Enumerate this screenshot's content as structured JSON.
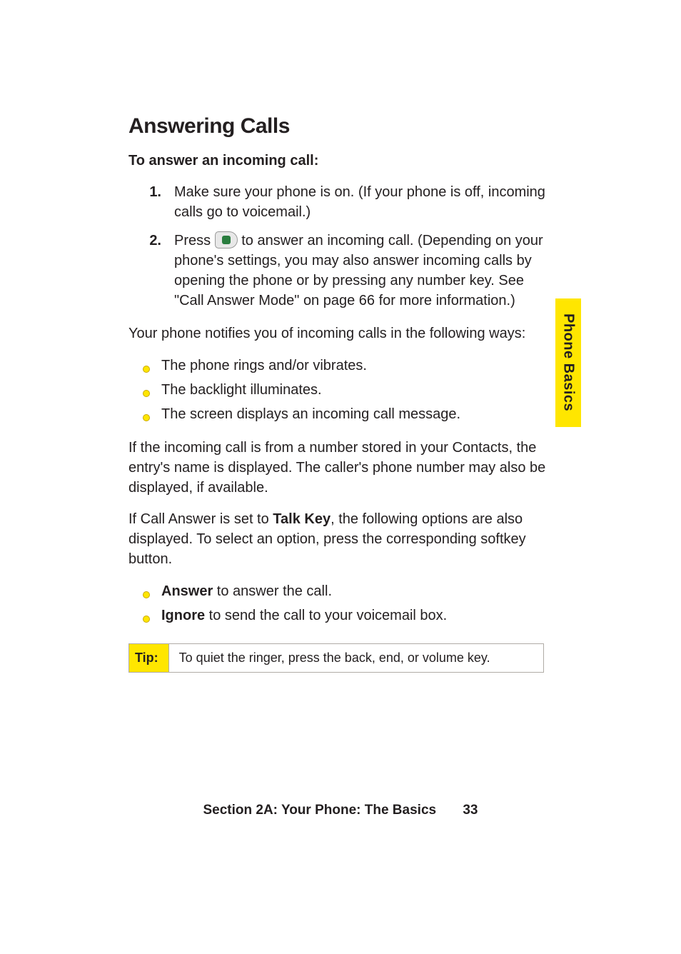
{
  "side_tab": {
    "label": "Phone Basics"
  },
  "heading": "Answering Calls",
  "subhead": "To answer an incoming call:",
  "steps": [
    {
      "marker": "1.",
      "text": "Make sure your phone is on. (If your phone is off, incoming calls go to voicemail.)"
    },
    {
      "marker": "2.",
      "prefix": "Press ",
      "suffix": " to answer an incoming call. (Depending on your phone's settings, you may also answer incoming calls by opening the phone or by pressing any number key. See \"Call Answer Mode\" on page 66 for more information.)",
      "icon_name": "talk-key-icon"
    }
  ],
  "notify_intro": "Your phone notifies you of incoming calls in the following ways:",
  "notify_bullets": [
    "The phone rings and/or vibrates.",
    "The backlight illuminates.",
    "The screen displays an incoming call message."
  ],
  "contacts_text": "If the incoming call is from a number stored in your Contacts, the entry's name is displayed. The caller's phone number may also be displayed, if available.",
  "talk_key_para": {
    "before": "If Call Answer is set to ",
    "bold": "Talk Key",
    "after": ", the following options are also displayed. To select an option, press the corresponding softkey button."
  },
  "option_bullets": [
    {
      "bold": "Answer",
      "rest": " to answer the call."
    },
    {
      "bold": "Ignore",
      "rest": " to send the call to your voicemail box."
    }
  ],
  "tip": {
    "label": "Tip:",
    "text": "To quiet the ringer, press the back, end, or volume key."
  },
  "footer": {
    "section_label": "Section 2A: Your Phone: The Basics",
    "page_number": "33"
  }
}
